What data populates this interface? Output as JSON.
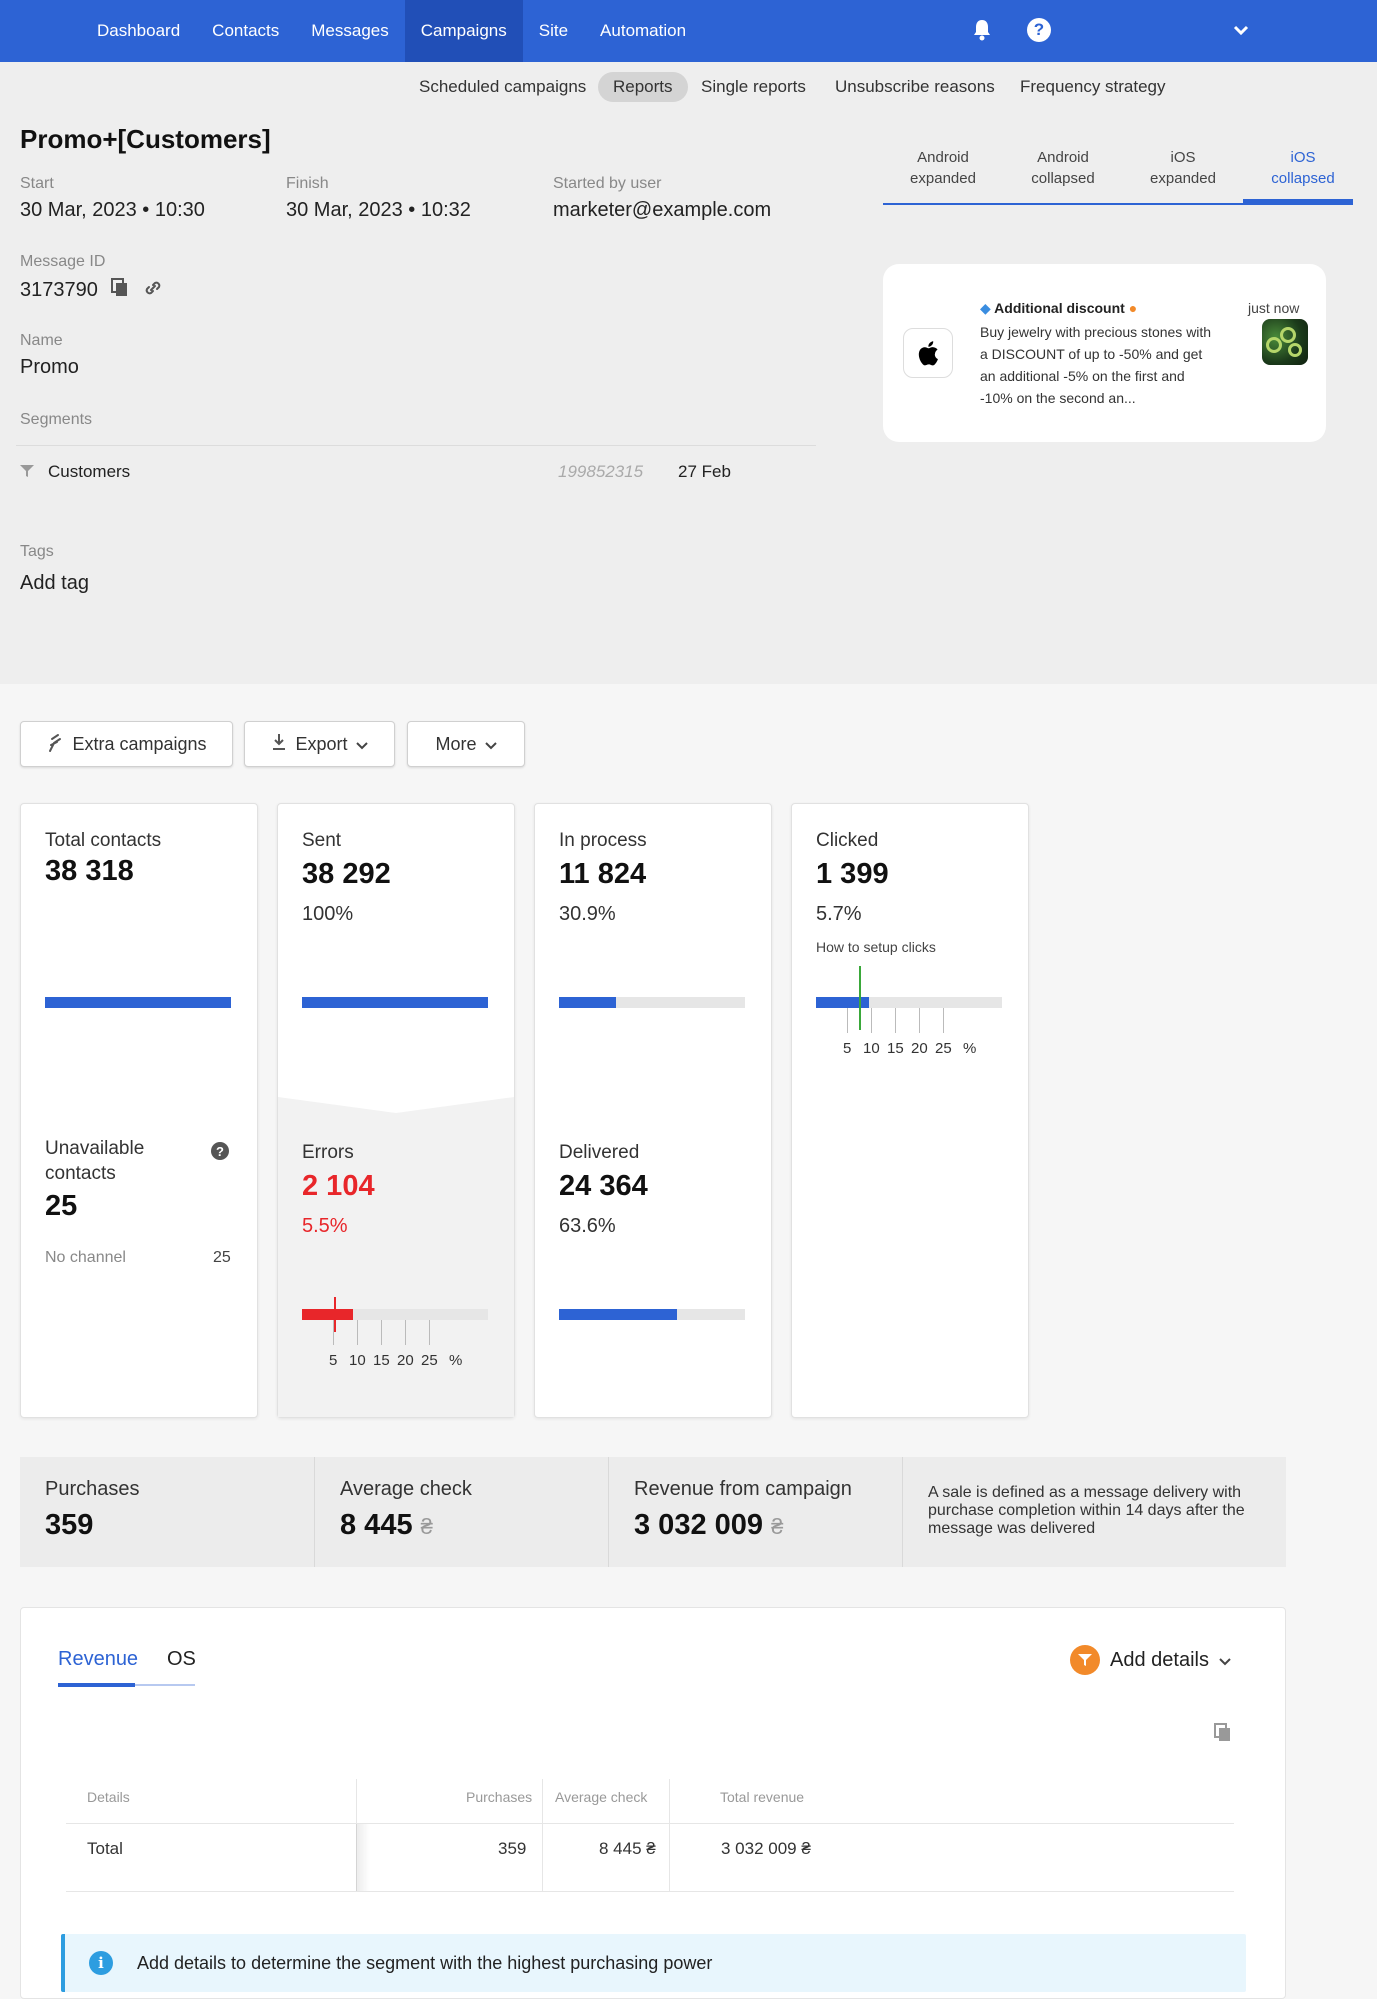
{
  "nav": {
    "items": [
      {
        "label": "Dashboard"
      },
      {
        "label": "Contacts"
      },
      {
        "label": "Messages"
      },
      {
        "label": "Campaigns",
        "active": true
      },
      {
        "label": "Site"
      },
      {
        "label": "Automation"
      }
    ],
    "icons": {
      "bell": "bell-icon",
      "help": "help-icon",
      "chevron": "chevron-down-icon"
    }
  },
  "subtabs": [
    {
      "label": "Scheduled campaigns"
    },
    {
      "label": "Reports",
      "active": true
    },
    {
      "label": "Single reports"
    },
    {
      "label": "Unsubscribe reasons"
    },
    {
      "label": "Frequency strategy"
    }
  ],
  "campaign": {
    "title": "Promo+[Customers]",
    "start_label": "Start",
    "start_value": "30 Mar, 2023 • 10:30",
    "finish_label": "Finish",
    "finish_value": "30 Mar, 2023 • 10:32",
    "started_by_label": "Started by user",
    "started_by_value": "marketer@example.com",
    "message_id_label": "Message ID",
    "message_id_value": "3173790",
    "name_label": "Name",
    "name_value": "Promo",
    "segments_label": "Segments",
    "segment": {
      "name": "Customers",
      "id": "199852315",
      "date": "27 Feb"
    },
    "tags_label": "Tags",
    "add_tag": "Add tag"
  },
  "preview": {
    "tabs": [
      {
        "line1": "Android",
        "line2": "expanded"
      },
      {
        "line1": "Android",
        "line2": "collapsed"
      },
      {
        "line1": "iOS",
        "line2": "expanded"
      },
      {
        "line1": "iOS",
        "line2": "collapsed",
        "active": true
      }
    ],
    "notification": {
      "title": "Additional discount",
      "body": "Buy jewelry with precious stones with a DISCOUNT of up to -50% and get an additional -5% on the first and -10% on the second an...",
      "time": "just now"
    }
  },
  "actions": {
    "extra": "Extra campaigns",
    "export": "Export",
    "more": "More"
  },
  "stats": {
    "total_contacts": {
      "label": "Total contacts",
      "value": "38 318",
      "fill": 1.0
    },
    "unavailable": {
      "label": "Unavailable contacts",
      "value": "25",
      "no_channel_label": "No channel",
      "no_channel_value": "25"
    },
    "sent": {
      "label": "Sent",
      "value": "38 292",
      "pct": "100%",
      "fill": 1.0
    },
    "errors": {
      "label": "Errors",
      "value": "2 104",
      "pct": "5.5%",
      "fill": 0.055
    },
    "in_process": {
      "label": "In process",
      "value": "11 824",
      "pct": "30.9%",
      "fill": 0.309
    },
    "delivered": {
      "label": "Delivered",
      "value": "24 364",
      "pct": "63.6%",
      "fill": 0.636
    },
    "clicked": {
      "label": "Clicked",
      "value": "1 399",
      "pct": "5.7%",
      "help_link": "How to setup clicks",
      "fill": 0.057
    },
    "scale": [
      "5",
      "10",
      "15",
      "20",
      "25",
      "%"
    ]
  },
  "purchases": {
    "purchases_label": "Purchases",
    "purchases_value": "359",
    "avg_check_label": "Average check",
    "avg_check_value": "8 445",
    "revenue_label": "Revenue from campaign",
    "revenue_value": "3 032 009",
    "currency": "₴",
    "note": "A sale is defined as a message delivery with purchase completion within 14 days after the message was delivered"
  },
  "revenue_panel": {
    "tabs": [
      {
        "label": "Revenue",
        "active": true
      },
      {
        "label": "OS"
      }
    ],
    "add_details": "Add details",
    "table": {
      "headers": [
        "Details",
        "Purchases",
        "Average check",
        "Total revenue"
      ],
      "rows": [
        [
          "Total",
          "359",
          "8 445 ₴",
          "3 032 009 ₴"
        ]
      ]
    },
    "info": "Add details to determine the segment with the highest purchasing power"
  },
  "colors": {
    "primary": "#2d63d4",
    "error": "#e8262a",
    "accent_orange": "#f28a2a",
    "info": "#2d9de0"
  }
}
